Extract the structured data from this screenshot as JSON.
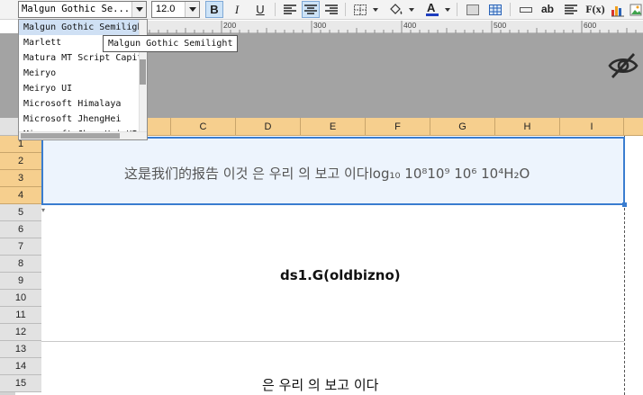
{
  "toolbar": {
    "font_name": "Malgun Gothic Se...",
    "font_size": "12.0",
    "bold": "B",
    "italic": "I",
    "underline": "U",
    "wrap_label": "ab",
    "formula_label": "F(x)",
    "text_color": "#1f3fbf",
    "fill_color": "#ffd400",
    "icons": [
      "align-left-icon",
      "align-center-icon",
      "align-right-icon",
      "border-icon",
      "fill-color-icon",
      "font-color-icon",
      "merge-icon",
      "grid-icon",
      "textbox-icon",
      "wrap-text-icon",
      "paragraph-icon",
      "formula-icon",
      "chart-icon",
      "image-icon"
    ]
  },
  "ruler": {
    "labels": [
      "200",
      "300",
      "400",
      "500",
      "600"
    ]
  },
  "columns": [
    "C",
    "D",
    "E",
    "F",
    "G",
    "H",
    "I"
  ],
  "rows": [
    "1",
    "2",
    "3",
    "4",
    "5",
    "6",
    "7",
    "8",
    "9",
    "10",
    "11",
    "12",
    "13",
    "14",
    "15"
  ],
  "sheet": {
    "title_text": "这是我们的报告 이것 은 우리 의 보고 이다log₁₀  10⁸10⁹  10⁶  10⁴H₂O",
    "field_text": "ds1.G(oldbizno)",
    "bottom_text": "은 우리 의 보고 이다"
  },
  "font_dropdown": {
    "items": [
      "Malgun Gothic Semilight",
      "Marlett",
      "Matura MT Script Capitals",
      "Meiryo",
      "Meiryo UI",
      "Microsoft Himalaya",
      "Microsoft JhengHei",
      "Microsoft JhengHei UI"
    ],
    "highlighted_index": 0,
    "tooltip": "Malgun Gothic Semilight"
  },
  "colors": {
    "band": "#a3a3a3",
    "header_orange": "#f6cf8e",
    "selection": "#3a7dd0"
  }
}
